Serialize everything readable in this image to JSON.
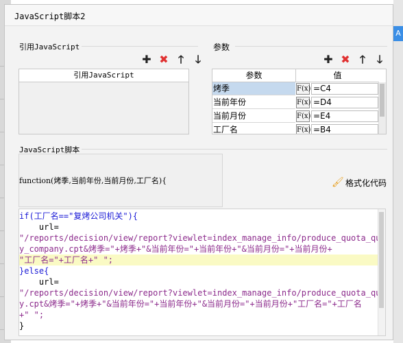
{
  "dialog": {
    "title": "JavaScript脚本2"
  },
  "colors": {
    "accent_blue": "#3a8ee6",
    "delete_red": "#e03030",
    "selected_row": "#c5d9ee",
    "highlight_line": "#fafac4",
    "keyword": "#1a1ad6",
    "string": "#8c2b8c"
  },
  "ref_section": {
    "label": "引用JavaScript",
    "table_header": "引用JavaScript",
    "toolbar": {
      "add_icon": "plus-icon",
      "delete_icon": "cross-icon",
      "up_icon": "arrow-up-icon",
      "down_icon": "arrow-down-icon"
    }
  },
  "param_section": {
    "label": "参数",
    "headers": {
      "name": "参数",
      "value": "值"
    },
    "formula_button": "F(x)",
    "rows": [
      {
        "name": "烤季",
        "value": "=C4",
        "selected": true
      },
      {
        "name": "当前年份",
        "value": "=D4",
        "selected": false
      },
      {
        "name": "当前月份",
        "value": "=E4",
        "selected": false
      },
      {
        "name": "工厂名",
        "value": "=B4",
        "selected": false
      }
    ]
  },
  "script_section": {
    "label": "JavaScript脚本",
    "signature": "function(烤季,当前年份,当前月份,工厂名){",
    "format_button": "格式化代码",
    "code_lines": [
      "if(工厂名==\"复烤公司机关\"){",
      "    url=",
      "\"/reports/decision/view/report?viewlet=index_manage_info/produce_quota_quer",
      "y_company.cpt&烤季=\"+烤季+\"&当前年份=\"+当前年份+\"&当前月份=\"+当前月份+",
      "\"工厂名=\"+工厂名+\" \";",
      "}else{",
      "    url=",
      "\"/reports/decision/view/report?viewlet=index_manage_info/produce_quota_quer",
      "y.cpt&烤季=\"+烤季+\"&当前年份=\"+当前年份+\"&当前月份=\"+当前月份+\"工厂名=\"+工厂名",
      "+\" \";",
      "}"
    ]
  },
  "side_accent": "A"
}
